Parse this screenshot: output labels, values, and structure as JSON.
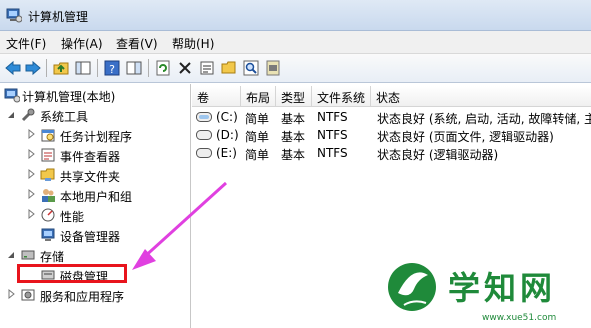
{
  "window": {
    "title": "计算机管理"
  },
  "menu": [
    "文件(F)",
    "操作(A)",
    "查看(V)",
    "帮助(H)"
  ],
  "toolbar": {
    "icons": [
      "back-icon",
      "forward-icon",
      "up-folder-icon",
      "show-hide-tree-icon",
      "help-icon",
      "properties-pane-icon",
      "refresh-icon",
      "delete-icon",
      "properties-icon",
      "open-folder-icon",
      "search-icon",
      "export-icon"
    ]
  },
  "tree": {
    "root": "计算机管理(本地)",
    "system_tools": "系统工具",
    "task_scheduler": "任务计划程序",
    "event_viewer": "事件查看器",
    "shared_folders": "共享文件夹",
    "local_users": "本地用户和组",
    "performance": "性能",
    "device_manager": "设备管理器",
    "storage": "存储",
    "disk_management": "磁盘管理",
    "services": "服务和应用程序"
  },
  "table": {
    "columns": [
      "卷",
      "布局",
      "类型",
      "文件系统",
      "状态"
    ],
    "rows": [
      {
        "volume": "(C:)",
        "layout": "简单",
        "type": "基本",
        "fs": "NTFS",
        "status": "状态良好 (系统, 启动, 活动, 故障转储, 主"
      },
      {
        "volume": "(D:)",
        "layout": "简单",
        "type": "基本",
        "fs": "NTFS",
        "status": "状态良好 (页面文件, 逻辑驱动器)"
      },
      {
        "volume": "(E:)",
        "layout": "简单",
        "type": "基本",
        "fs": "NTFS",
        "status": "状态良好 (逻辑驱动器)"
      }
    ]
  },
  "watermark": {
    "text": "学知网",
    "url": "www.xue51.com"
  },
  "colors": {
    "highlight": "#e8141c",
    "arrow": "#e040e0",
    "watermark_green": "#1f8a3a"
  }
}
